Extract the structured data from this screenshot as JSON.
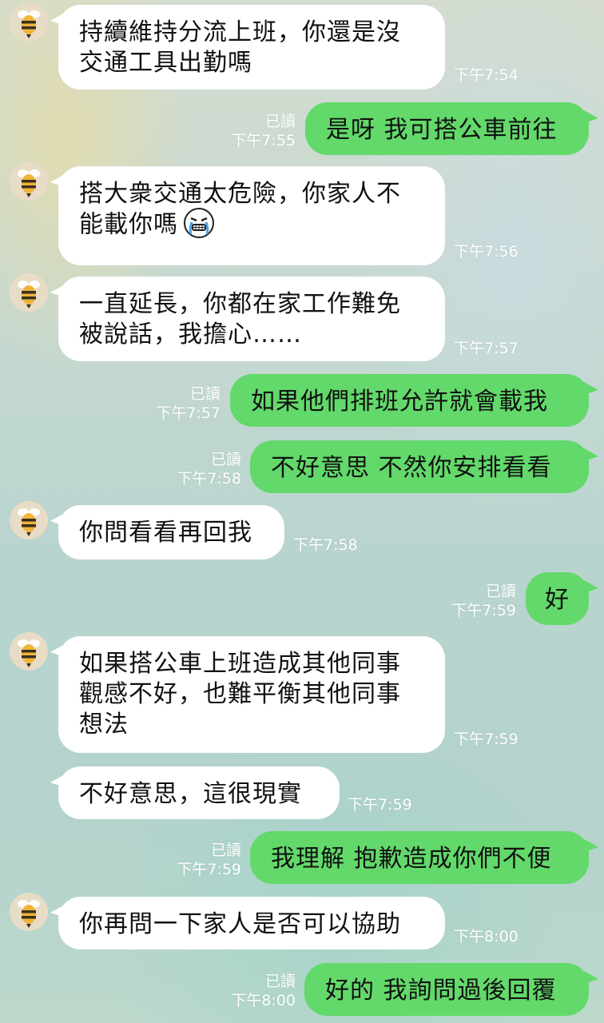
{
  "contact": {
    "avatar_icon": "bee-icon"
  },
  "read_label": "已讀",
  "messages": [
    {
      "dir": "in",
      "text": "持續維持分流上班，你還是沒\n交通工具出勤嗎",
      "time": "下午7:54"
    },
    {
      "dir": "out",
      "text": "是呀 我可搭公車前往",
      "time": "下午7:55",
      "read": true
    },
    {
      "dir": "in",
      "text": "搭大衆交通太危險，你家人不\n能載你嗎",
      "time": "下午7:56",
      "emoji": "crying-emoji-icon"
    },
    {
      "dir": "in",
      "text": "一直延長，你都在家工作難免\n被說話，我擔心……",
      "time": "下午7:57"
    },
    {
      "dir": "out",
      "text": "如果他們排班允許就會載我",
      "time": "下午7:57",
      "read": true
    },
    {
      "dir": "out",
      "text": "不好意思 不然你安排看看",
      "time": "下午7:58",
      "read": true
    },
    {
      "dir": "in",
      "text": "你問看看再回我",
      "time": "下午7:58"
    },
    {
      "dir": "out",
      "text": "好",
      "time": "下午7:59",
      "read": true
    },
    {
      "dir": "in",
      "text": "如果搭公車上班造成其他同事\n觀感不好，也難平衡其他同事\n想法",
      "time": "下午7:59"
    },
    {
      "dir": "in",
      "text": "不好意思，這很現實",
      "time": "下午7:59"
    },
    {
      "dir": "out",
      "text": "我理解 抱歉造成你們不便",
      "time": "下午7:59",
      "read": true
    },
    {
      "dir": "in",
      "text": "你再問一下家人是否可以協助",
      "time": "下午8:00"
    },
    {
      "dir": "out",
      "text": "好的 我詢問過後回覆",
      "time": "下午8:00",
      "read": true
    }
  ],
  "colors": {
    "outgoing_bubble": "#62d96a",
    "incoming_bubble": "#ffffff",
    "meta_text": "#ffffff"
  }
}
